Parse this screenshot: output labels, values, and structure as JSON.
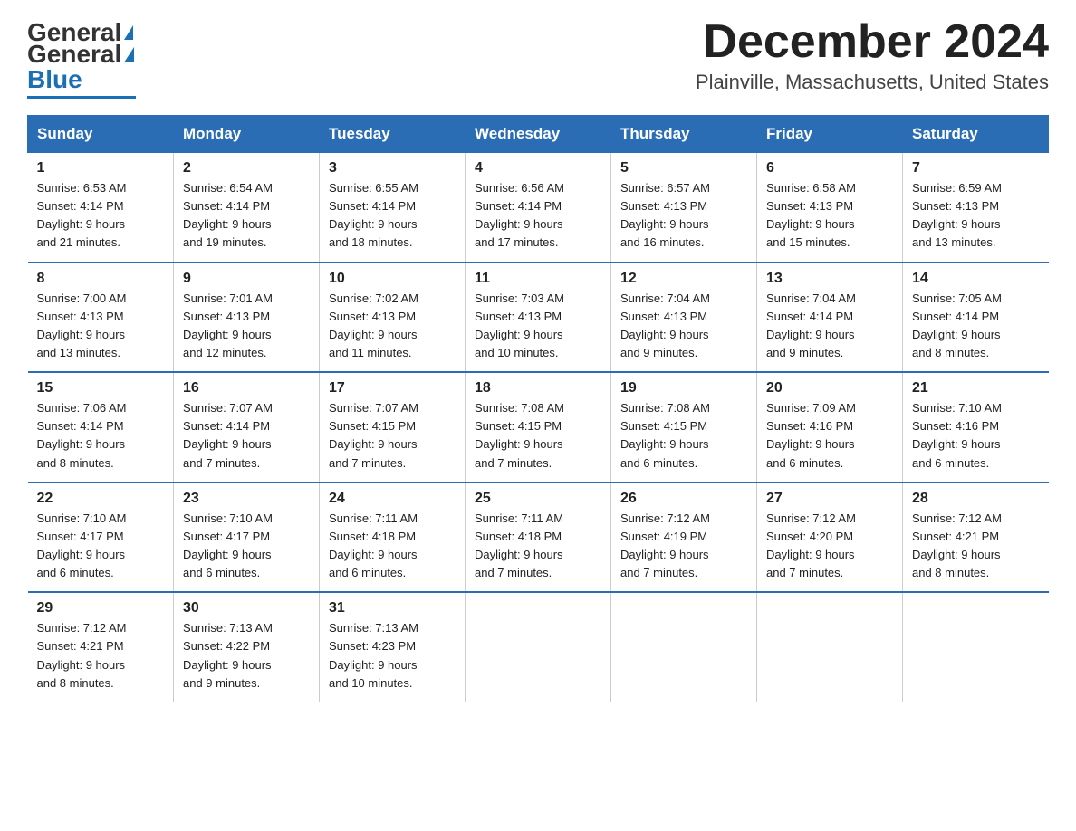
{
  "header": {
    "logo_general": "General",
    "logo_blue": "Blue",
    "month_title": "December 2024",
    "location": "Plainville, Massachusetts, United States"
  },
  "weekdays": [
    "Sunday",
    "Monday",
    "Tuesday",
    "Wednesday",
    "Thursday",
    "Friday",
    "Saturday"
  ],
  "weeks": [
    [
      {
        "day": "1",
        "sunrise": "6:53 AM",
        "sunset": "4:14 PM",
        "daylight": "9 hours and 21 minutes."
      },
      {
        "day": "2",
        "sunrise": "6:54 AM",
        "sunset": "4:14 PM",
        "daylight": "9 hours and 19 minutes."
      },
      {
        "day": "3",
        "sunrise": "6:55 AM",
        "sunset": "4:14 PM",
        "daylight": "9 hours and 18 minutes."
      },
      {
        "day": "4",
        "sunrise": "6:56 AM",
        "sunset": "4:14 PM",
        "daylight": "9 hours and 17 minutes."
      },
      {
        "day": "5",
        "sunrise": "6:57 AM",
        "sunset": "4:13 PM",
        "daylight": "9 hours and 16 minutes."
      },
      {
        "day": "6",
        "sunrise": "6:58 AM",
        "sunset": "4:13 PM",
        "daylight": "9 hours and 15 minutes."
      },
      {
        "day": "7",
        "sunrise": "6:59 AM",
        "sunset": "4:13 PM",
        "daylight": "9 hours and 13 minutes."
      }
    ],
    [
      {
        "day": "8",
        "sunrise": "7:00 AM",
        "sunset": "4:13 PM",
        "daylight": "9 hours and 13 minutes."
      },
      {
        "day": "9",
        "sunrise": "7:01 AM",
        "sunset": "4:13 PM",
        "daylight": "9 hours and 12 minutes."
      },
      {
        "day": "10",
        "sunrise": "7:02 AM",
        "sunset": "4:13 PM",
        "daylight": "9 hours and 11 minutes."
      },
      {
        "day": "11",
        "sunrise": "7:03 AM",
        "sunset": "4:13 PM",
        "daylight": "9 hours and 10 minutes."
      },
      {
        "day": "12",
        "sunrise": "7:04 AM",
        "sunset": "4:13 PM",
        "daylight": "9 hours and 9 minutes."
      },
      {
        "day": "13",
        "sunrise": "7:04 AM",
        "sunset": "4:14 PM",
        "daylight": "9 hours and 9 minutes."
      },
      {
        "day": "14",
        "sunrise": "7:05 AM",
        "sunset": "4:14 PM",
        "daylight": "9 hours and 8 minutes."
      }
    ],
    [
      {
        "day": "15",
        "sunrise": "7:06 AM",
        "sunset": "4:14 PM",
        "daylight": "9 hours and 8 minutes."
      },
      {
        "day": "16",
        "sunrise": "7:07 AM",
        "sunset": "4:14 PM",
        "daylight": "9 hours and 7 minutes."
      },
      {
        "day": "17",
        "sunrise": "7:07 AM",
        "sunset": "4:15 PM",
        "daylight": "9 hours and 7 minutes."
      },
      {
        "day": "18",
        "sunrise": "7:08 AM",
        "sunset": "4:15 PM",
        "daylight": "9 hours and 7 minutes."
      },
      {
        "day": "19",
        "sunrise": "7:08 AM",
        "sunset": "4:15 PM",
        "daylight": "9 hours and 6 minutes."
      },
      {
        "day": "20",
        "sunrise": "7:09 AM",
        "sunset": "4:16 PM",
        "daylight": "9 hours and 6 minutes."
      },
      {
        "day": "21",
        "sunrise": "7:10 AM",
        "sunset": "4:16 PM",
        "daylight": "9 hours and 6 minutes."
      }
    ],
    [
      {
        "day": "22",
        "sunrise": "7:10 AM",
        "sunset": "4:17 PM",
        "daylight": "9 hours and 6 minutes."
      },
      {
        "day": "23",
        "sunrise": "7:10 AM",
        "sunset": "4:17 PM",
        "daylight": "9 hours and 6 minutes."
      },
      {
        "day": "24",
        "sunrise": "7:11 AM",
        "sunset": "4:18 PM",
        "daylight": "9 hours and 6 minutes."
      },
      {
        "day": "25",
        "sunrise": "7:11 AM",
        "sunset": "4:18 PM",
        "daylight": "9 hours and 7 minutes."
      },
      {
        "day": "26",
        "sunrise": "7:12 AM",
        "sunset": "4:19 PM",
        "daylight": "9 hours and 7 minutes."
      },
      {
        "day": "27",
        "sunrise": "7:12 AM",
        "sunset": "4:20 PM",
        "daylight": "9 hours and 7 minutes."
      },
      {
        "day": "28",
        "sunrise": "7:12 AM",
        "sunset": "4:21 PM",
        "daylight": "9 hours and 8 minutes."
      }
    ],
    [
      {
        "day": "29",
        "sunrise": "7:12 AM",
        "sunset": "4:21 PM",
        "daylight": "9 hours and 8 minutes."
      },
      {
        "day": "30",
        "sunrise": "7:13 AM",
        "sunset": "4:22 PM",
        "daylight": "9 hours and 9 minutes."
      },
      {
        "day": "31",
        "sunrise": "7:13 AM",
        "sunset": "4:23 PM",
        "daylight": "9 hours and 10 minutes."
      },
      null,
      null,
      null,
      null
    ]
  ],
  "labels": {
    "sunrise": "Sunrise:",
    "sunset": "Sunset:",
    "daylight": "Daylight:"
  }
}
